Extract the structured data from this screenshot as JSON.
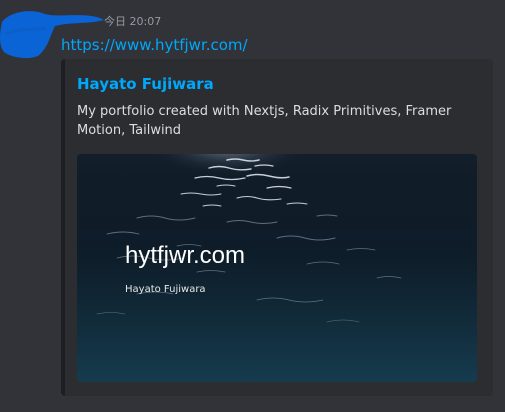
{
  "message": {
    "timestamp": "今日 20:07",
    "link_text": "https://www.hytfjwr.com/"
  },
  "embed": {
    "title": "Hayato Fujiwara",
    "description": "My portfolio created with Nextjs, Radix Primitives, Framer Motion, Tailwind",
    "image": {
      "site_text": "hytfjwr.com",
      "author_text": "Hayato Fujiwara"
    }
  },
  "colors": {
    "background": "#313338",
    "embed_background": "#2b2d31",
    "link": "#00a8fc",
    "scribble": "#0a64d6",
    "muted_text": "#949ba4"
  }
}
